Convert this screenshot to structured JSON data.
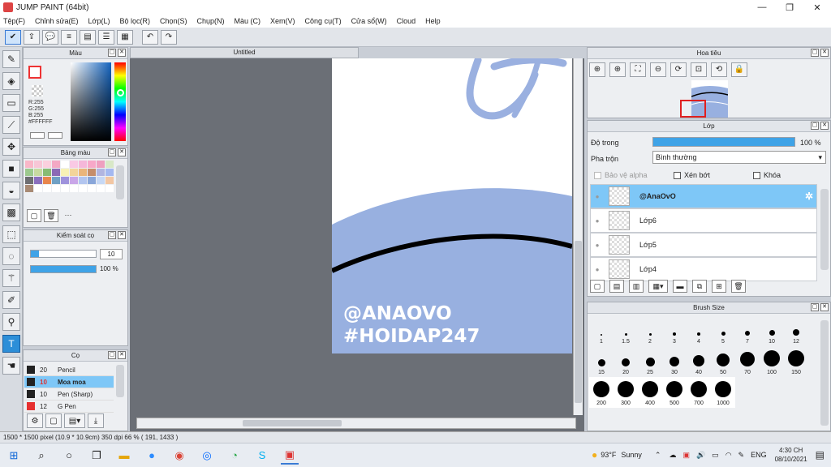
{
  "window": {
    "title": "JUMP PAINT (64bit)",
    "minimize": "—",
    "maximize": "❐",
    "close": "✕"
  },
  "menu": [
    "Tệp(F)",
    "Chỉnh sửa(E)",
    "Lớp(L)",
    "Bộ lọc(R)",
    "Chọn(S)",
    "Chụp(N)",
    "Màu (C)",
    "Xem(V)",
    "Công cụ(T)",
    "Cửa sổ(W)",
    "Cloud",
    "Help"
  ],
  "toolbar_icons": [
    "check-icon",
    "share-icon",
    "comment-icon",
    "list-icon",
    "document-icon",
    "table-icon",
    "grid-icon",
    "undo-icon",
    "redo-icon"
  ],
  "tools": [
    "pen-icon",
    "eraser-icon",
    "rect-icon",
    "brush-icon",
    "move-icon",
    "fill-icon",
    "bucket-icon",
    "gradient-icon",
    "marquee-icon",
    "lasso-icon",
    "wand-icon",
    "pencil-select-icon",
    "stamp-icon",
    "text-icon",
    "hand-icon"
  ],
  "color_panel": {
    "title": "Màu",
    "r": "R:255",
    "g": "G:255",
    "b": "B:255",
    "hex": "#FFFFFF",
    "fg_color": "#ffffff",
    "border_color": "#e33333"
  },
  "palette_panel": {
    "title": "Bảng màu",
    "colors": [
      "#f9b7c8",
      "#f7c6d6",
      "#fbd0de",
      "#f3a8c4",
      "#ffffff",
      "#f9c9e4",
      "#f5b7d9",
      "#f7a8c8",
      "#ee9fbf",
      "#d8e8c7",
      "#9cc98e",
      "#c7d9a1",
      "#88bc74",
      "#8b6ab5",
      "#f7f2b6",
      "#f3d59a",
      "#eab57a",
      "#c58d6a",
      "#b1b5e0",
      "#a4b8f0",
      "#6d6e72",
      "#8a6fbe",
      "#e8864c",
      "#6fa0c4",
      "#9e92dc",
      "#c9a6e8",
      "#b2c5ef",
      "#89a6d9",
      "#c6d8f5",
      "#f2c6a3",
      "#a88a74",
      "#ffffff",
      "#ffffff",
      "#ffffff",
      "#ffffff",
      "#ffffff",
      "#ffffff",
      "#ffffff",
      "#ffffff",
      "#ffffff"
    ],
    "menu": "···"
  },
  "brush_control": {
    "title": "Kiểm soát cọ",
    "size_value": "10",
    "opacity_value": "100 %",
    "size_fill_pct": 12,
    "opacity_fill_pct": 100
  },
  "brush_list": {
    "title": "Cọ",
    "items": [
      {
        "size": "20",
        "name": "Pencil",
        "color": "#222222",
        "selected": false
      },
      {
        "size": "10",
        "name": "Moa moa",
        "color": "#222222",
        "selected": true
      },
      {
        "size": "10",
        "name": "Pen (Sharp)",
        "color": "#222222",
        "selected": false
      },
      {
        "size": "12",
        "name": "G Pen",
        "color": "#e63030",
        "selected": false
      }
    ]
  },
  "document": {
    "tab": "Untitled",
    "watermark_line1": "@ANAOVO",
    "watermark_line2": "#HOIDAP247"
  },
  "navigator": {
    "title": "Hoa tiêu"
  },
  "layer_panel": {
    "title": "Lớp",
    "opacity_label": "Độ trong",
    "opacity_value": "100 %",
    "blend_label": "Pha trộn",
    "blend_value": "Bình thường",
    "protect_alpha": "Bảo vệ alpha",
    "clipping": "Xén bớt",
    "lock": "Khóa",
    "layers": [
      {
        "name": "@AnaOvO",
        "selected": true
      },
      {
        "name": "Lớp6",
        "selected": false
      },
      {
        "name": "Lớp5",
        "selected": false
      },
      {
        "name": "Lớp4",
        "selected": false
      }
    ]
  },
  "brush_size_panel": {
    "title": "Brush Size",
    "sizes": [
      "1",
      "1.5",
      "2",
      "3",
      "4",
      "5",
      "7",
      "10",
      "12",
      "15",
      "20",
      "25",
      "30",
      "40",
      "50",
      "70",
      "100",
      "150",
      "200",
      "300",
      "400",
      "500",
      "700",
      "1000"
    ]
  },
  "status": {
    "text": "1500 * 1500 pixel  (10.9 * 10.9cm)  350 dpi  66 %  ( 191, 1433 )"
  },
  "taskbar": {
    "weather_temp": "93°F",
    "weather_desc": "Sunny",
    "lang": "ENG",
    "time": "4:30 CH",
    "date": "08/10/2021"
  }
}
